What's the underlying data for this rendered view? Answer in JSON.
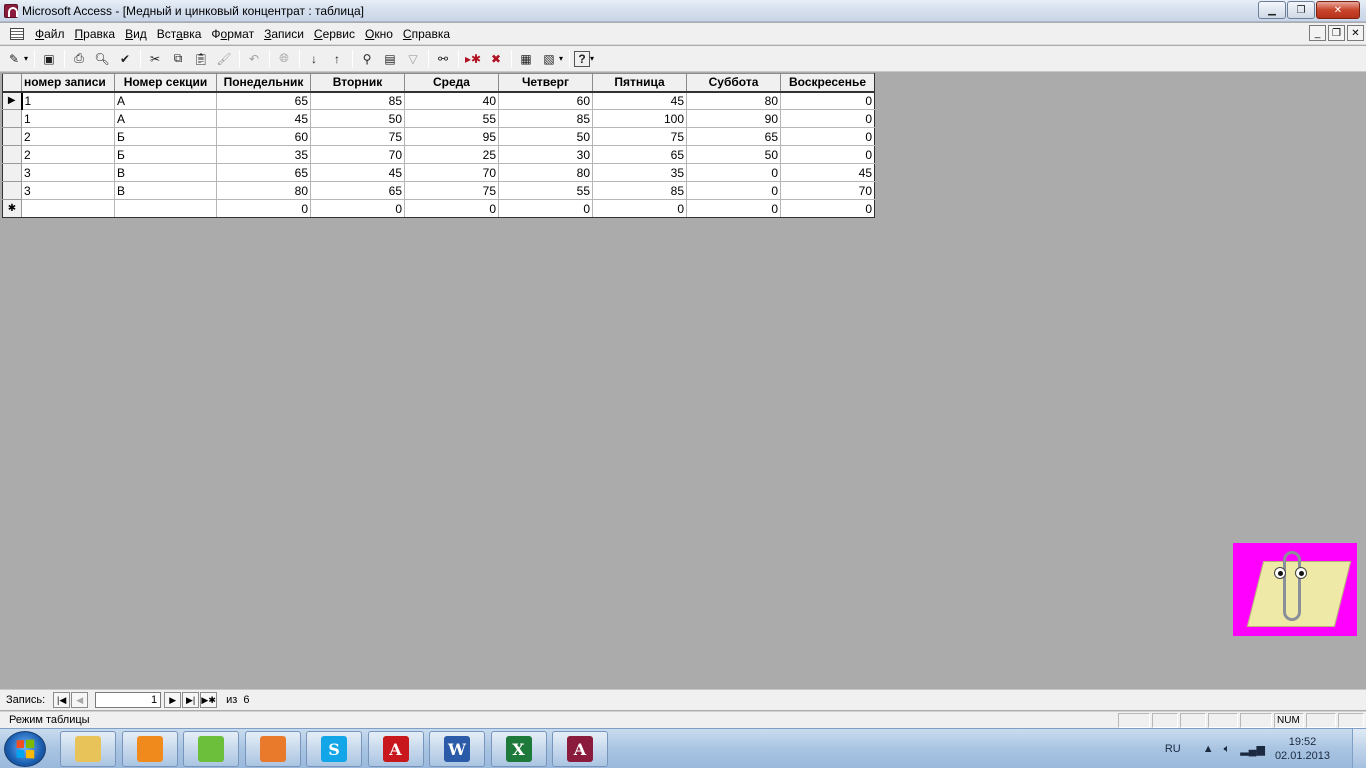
{
  "window": {
    "title": "Microsoft Access - [Медный и цинковый концентрат : таблица]"
  },
  "menu": [
    {
      "pre": "",
      "u": "Ф",
      "post": "айл"
    },
    {
      "pre": "",
      "u": "П",
      "post": "равка"
    },
    {
      "pre": "",
      "u": "В",
      "post": "ид"
    },
    {
      "pre": "Вст",
      "u": "а",
      "post": "вка"
    },
    {
      "pre": "Ф",
      "u": "о",
      "post": "рмат"
    },
    {
      "pre": "",
      "u": "З",
      "post": "аписи"
    },
    {
      "pre": "",
      "u": "С",
      "post": "ервис"
    },
    {
      "pre": "",
      "u": "О",
      "post": "кно"
    },
    {
      "pre": "",
      "u": "С",
      "post": "правка"
    }
  ],
  "table": {
    "columns": [
      "номер записи",
      "Номер секции",
      "Понедельник",
      "Вторник",
      "Среда",
      "Четверг",
      "Пятница",
      "Суббота",
      "Воскресенье"
    ],
    "rows": [
      [
        "1",
        "А",
        "65",
        "85",
        "40",
        "60",
        "45",
        "80",
        "0"
      ],
      [
        "1",
        "А",
        "45",
        "50",
        "55",
        "85",
        "100",
        "90",
        "0"
      ],
      [
        "2",
        "Б",
        "60",
        "75",
        "95",
        "50",
        "75",
        "65",
        "0"
      ],
      [
        "2",
        "Б",
        "35",
        "70",
        "25",
        "30",
        "65",
        "50",
        "0"
      ],
      [
        "3",
        "В",
        "65",
        "45",
        "70",
        "80",
        "35",
        "0",
        "45"
      ],
      [
        "3",
        "В",
        "80",
        "65",
        "75",
        "55",
        "85",
        "0",
        "70"
      ]
    ],
    "new_row": [
      "",
      "",
      "0",
      "0",
      "0",
      "0",
      "0",
      "0",
      "0"
    ]
  },
  "navigator": {
    "label": "Запись:",
    "current": "1",
    "of_label": "из",
    "total": "6"
  },
  "statusbar": {
    "text": "Режим таблицы",
    "num": "NUM"
  },
  "taskbar": {
    "language": "RU",
    "time": "19:52",
    "date": "02.01.2013",
    "apps": [
      {
        "name": "explorer",
        "glyph": "",
        "color": "#e8c35a"
      },
      {
        "name": "media-player",
        "glyph": "",
        "color": "#f08a1c"
      },
      {
        "name": "app-green",
        "glyph": "",
        "color": "#6cbf3a"
      },
      {
        "name": "app-orange",
        "glyph": "",
        "color": "#e9792b"
      },
      {
        "name": "skype",
        "glyph": "S",
        "color": "#12a5e8"
      },
      {
        "name": "acrobat",
        "glyph": "A",
        "color": "#c8171d"
      },
      {
        "name": "word",
        "glyph": "W",
        "color": "#2a5aa8"
      },
      {
        "name": "excel",
        "glyph": "X",
        "color": "#1d7a3a"
      },
      {
        "name": "access",
        "glyph": "A",
        "color": "#8a1b3d"
      }
    ]
  }
}
